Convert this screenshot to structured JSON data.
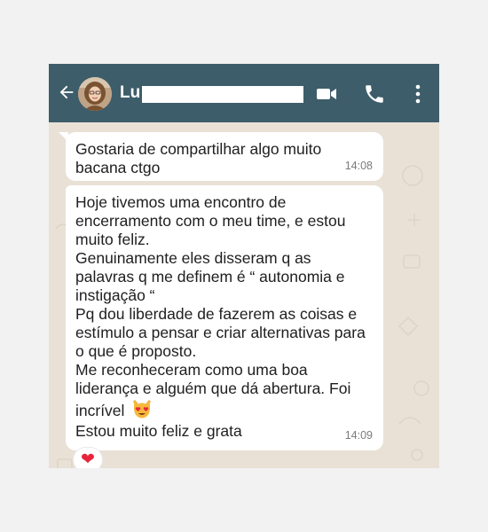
{
  "header": {
    "contact_name": "Lu",
    "icons": [
      "back-arrow-icon",
      "avatar",
      "video-call-icon",
      "phone-icon",
      "more-vert-icon"
    ]
  },
  "messages": [
    {
      "lines": [
        "Gostaria de compartilhar algo muito",
        "bacana ctgo"
      ],
      "time": "14:08"
    },
    {
      "lines": [
        "Hoje tivemos uma encontro de",
        "encerramento com o meu time, e estou",
        "muito feliz.",
        "Genuinamente eles disseram q as",
        "palavras q me definem é “ autonomia e",
        "instigação  “",
        "Pq dou liberdade de fazerem as coisas e",
        "estímulo a pensar e criar alternativas para",
        "o que é proposto.",
        "Me reconheceram como uma boa",
        "liderança e alguém que dá abertura. Foi",
        "incrível",
        "Estou muito feliz e grata"
      ],
      "emoji": "heart-eyes-cat-emoji",
      "time": "14:09",
      "reaction": "❤"
    }
  ],
  "colors": {
    "header_bg": "#3e5d6a",
    "chat_bg": "#e9e1d6",
    "bubble_bg": "#ffffff",
    "reaction_heart": "#e8243a"
  }
}
